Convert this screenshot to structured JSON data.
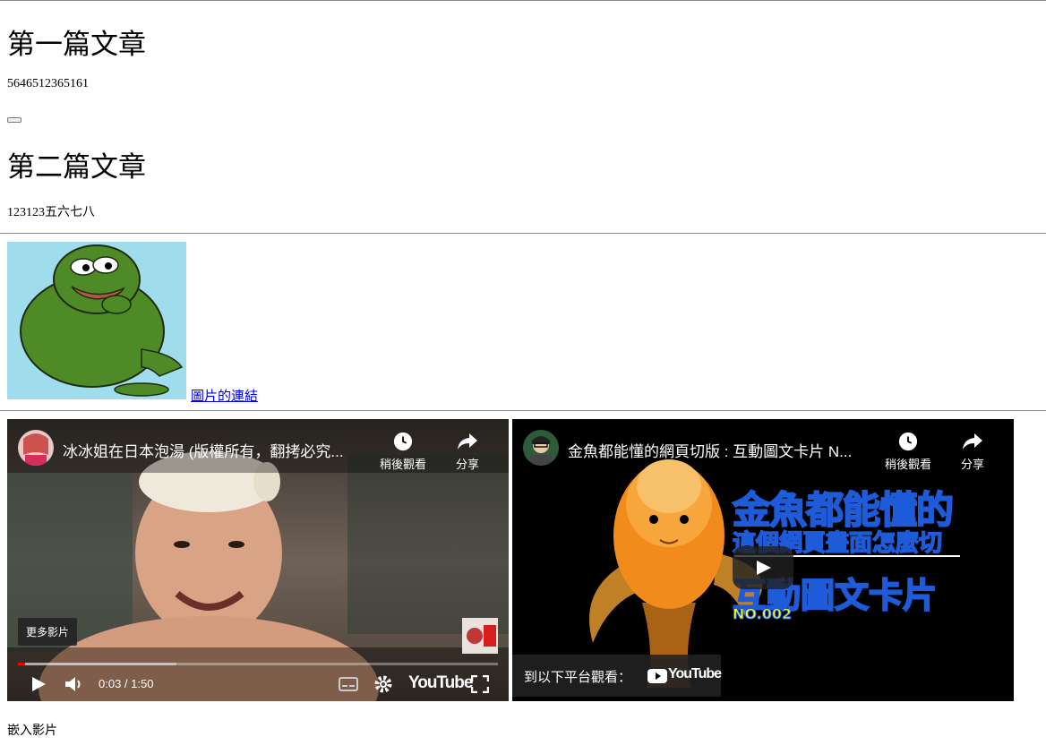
{
  "articles": [
    {
      "title": "第一篇文章",
      "body": "5646512365161"
    },
    {
      "title": "第二篇文章",
      "body": "123123五六七八"
    }
  ],
  "image_link_text": "圖片的連結",
  "videos": [
    {
      "title": "冰冰姐在日本泡湯 (版權所有，翻拷必究...",
      "watch_later": "稍後觀看",
      "share": "分享",
      "more_videos": "更多影片",
      "time": "0:03 / 1:50",
      "progress": 0.015,
      "buffered": 0.33,
      "brand": "YouTube"
    },
    {
      "title": "金魚都能懂的網頁切版 : 互動圖文卡片 N...",
      "watch_later": "稍後觀看",
      "share": "分享",
      "thumb_line1": "金魚都能懂的",
      "thumb_line2": "這個網頁畫面怎麼切",
      "thumb_line3": "互動圖文卡片",
      "thumb_line4": "NO.002",
      "watch_on": "到以下平台觀看：",
      "brand": "YouTube"
    }
  ],
  "caption": "嵌入影片",
  "colors": {
    "link": "#0000ee",
    "yt_red": "#ff0000",
    "thumb_yellow": "#f2f23a",
    "thumb_blue": "#1e5bd8"
  }
}
